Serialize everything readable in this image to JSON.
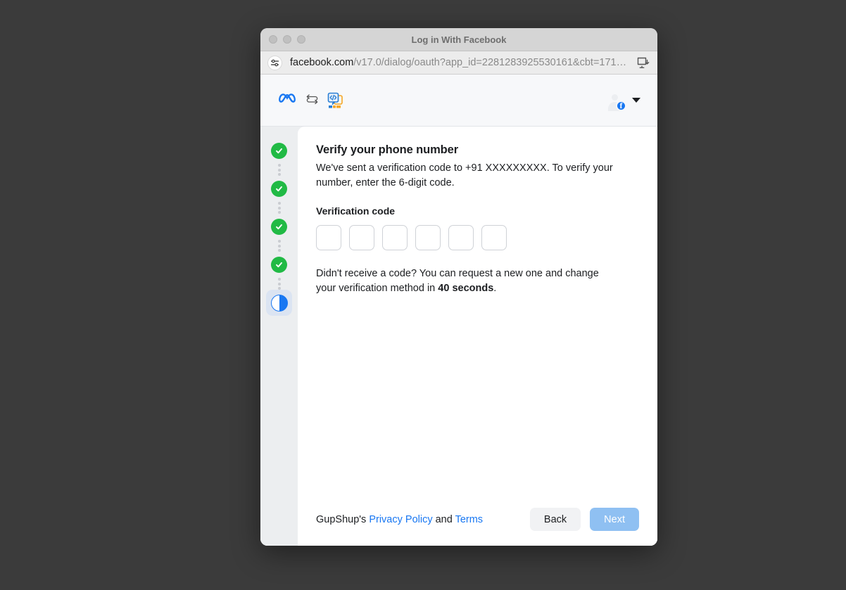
{
  "window": {
    "title": "Log in With Facebook",
    "traffic_lights": [
      "close",
      "minimize",
      "maximize"
    ]
  },
  "urlbar": {
    "page_settings_icon": "sliders-icon",
    "domain": "facebook.com",
    "path": "/v17.0/dialog/oauth?app_id=2281283925530161&cbt=171…",
    "download_icon": "screen-download-icon"
  },
  "header": {
    "meta_logo": "meta-infinity-logo",
    "sync_icon": "sync-arrows-icon",
    "partner_logo": "gupshup-logo",
    "avatar": "default-user-avatar",
    "avatar_badge": "f",
    "caret_icon": "chevron-down-icon"
  },
  "stepper": {
    "steps": [
      {
        "state": "complete",
        "icon": "check-icon"
      },
      {
        "state": "complete",
        "icon": "check-icon"
      },
      {
        "state": "complete",
        "icon": "check-icon"
      },
      {
        "state": "complete",
        "icon": "check-icon"
      },
      {
        "state": "in-progress",
        "icon": "half-circle-icon"
      }
    ],
    "complete_color": "#21ba45",
    "active_color": "#1877f2",
    "active_bg": "#dbe4f2"
  },
  "main": {
    "title": "Verify your phone number",
    "subtitle": "We've sent a verification code to +91 XXXXXXXXX. To verify your number, enter the 6-digit code.",
    "field_label": "Verification code",
    "code_inputs": [
      {
        "value": "",
        "placeholder": ""
      },
      {
        "value": "",
        "placeholder": ""
      },
      {
        "value": "",
        "placeholder": ""
      },
      {
        "value": "",
        "placeholder": ""
      },
      {
        "value": "",
        "placeholder": ""
      },
      {
        "value": "",
        "placeholder": ""
      }
    ],
    "resend_prefix": "Didn't receive a code? You can request a new one and change your verification method in ",
    "resend_timer": "40 seconds",
    "resend_suffix": "."
  },
  "footer": {
    "legal_prefix": "GupShup's ",
    "privacy_label": "Privacy Policy",
    "legal_middle": " and ",
    "terms_label": "Terms",
    "back_label": "Back",
    "next_label": "Next",
    "link_color": "#1877f2"
  }
}
